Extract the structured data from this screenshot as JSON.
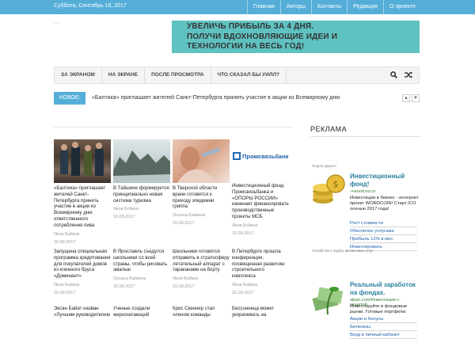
{
  "topbar": {
    "date": "Суббота, Сентябрь 16, 2017",
    "nav": [
      "Главная",
      "Авторы",
      "Контакты",
      "Редакция",
      "О проекте"
    ]
  },
  "logo_text": "...",
  "banner": {
    "lines": [
      "УВЕЛИЧЬ ПРИБЫЛЬ ЗА 4 ДНЯ.",
      "ПОЛУЧИ ВДОХНОВЛЯЮЩИЕ ИДЕИ И",
      "ТЕХНОЛОГИИ НА ВЕСЬ ГОД!"
    ],
    "color": "#5fc2c1"
  },
  "mainnav": {
    "items": [
      "ЗА ЭКРАНОМ",
      "НА ЭКРАНЕ",
      "ПОСЛЕ ПРОСМОТРА",
      "ЧТО СКАЗАЛ БЫ УИЛЛ?"
    ],
    "search_icon": "search-icon",
    "shuffle_icon": "shuffle-icon"
  },
  "ticker": {
    "label": "НОВОЕ:",
    "text": "«Балтика» приглашает жителей Санкт-Петербурга принять участие в акции ко Всемирному дню"
  },
  "articles": [
    {
      "title": "«Балтика» приглашает жителей Санкт-Петербурга принять участие в акции ко Всемирному дню ответственного потребления пива",
      "author": "Яков Бойков",
      "date": "16.09.2017"
    },
    {
      "title": "В Тайшине формируется принципиально новая система туризма",
      "author": "Яков Бойков",
      "date": "16.09.2017"
    },
    {
      "title": "В Тверской области врачи готовятся к приходу эпидемии гриппа",
      "author": "Оксана Байкина",
      "date": "15.09.2017"
    },
    {
      "title": "Инвестиционный фонд Промсвязьбанка и «ОПОРЫ РОССИИ» начинает финансировать производственные проекты МСБ",
      "author": "Яков Бойков",
      "date": "15.09.2017"
    },
    {
      "title": "Запущена специальная программа кредитования для покупателей домов из клееного бруса «Доминант»",
      "author": "Яков Бойков",
      "date": "15.09.2017"
    },
    {
      "title": "В Ярославль съедутся школьники со всей страны, чтобы рисовать эмалью",
      "author": "Оксана Байкина",
      "date": "15.09.2017"
    },
    {
      "title": "Школьники готовятся отправить в стратосферу летательный аппарат с тараканами на борту",
      "author": "Яков Бойков",
      "date": "15.09.2017"
    },
    {
      "title": "В Петербурге прошла конференция, посвященная развитию строительного комплекса",
      "author": "Яков Бойков",
      "date": "15.09.2017"
    },
    {
      "title": "Эксан Байат назван «Лучшим руководителем",
      "author": "",
      "date": ""
    },
    {
      "title": "Ученые создали жироскигающий",
      "author": "",
      "date": ""
    },
    {
      "title": "Крис Скиннер стал членом команды",
      "author": "",
      "date": ""
    },
    {
      "title": "Бессонница может укорачивать на",
      "author": "",
      "date": ""
    }
  ],
  "sidebar": {
    "title": "РЕКЛАМА",
    "ad_label": "Яндекс.Директ",
    "ads": [
      {
        "title": "Инвестиционный фонд!",
        "url": "↪wordcoin.io",
        "desc": "Инвестиции в бизнес - интернет проект WORDCOIN! Старт ICO осенью 2017 года!",
        "links": [
          "Рост стоимости",
          "Обеспечен услугами",
          "Прибыль 12% в мес.",
          "Инвестировать"
        ]
      },
      {
        "title": "Реальный заработок на фондах.",
        "url": "alpari.com/Инвестиции-с-защитой",
        "desc": "Инвестируйте в фондовые рынки. Готовые портфели.",
        "links": [
          "Акции и бонусы",
          "Биткоины",
          "Вход в личный кабинет"
        ]
      }
    ],
    "ad_footer": "Устройство и подбор финансовых услуг"
  },
  "psb_logo_text": "Промсвязьбанк",
  "colors": {
    "accent": "#54aed8",
    "banner": "#5fc2c1",
    "ad_title": "#2a7fa0"
  }
}
